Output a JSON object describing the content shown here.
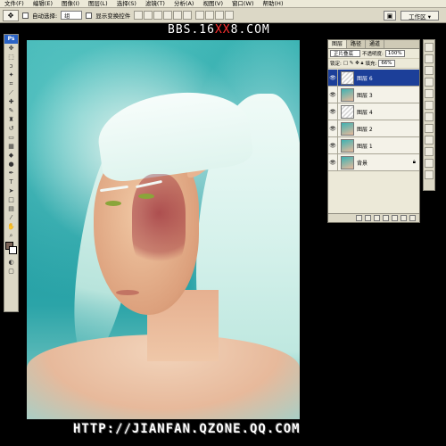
{
  "menu": [
    "文件(F)",
    "编辑(E)",
    "图像(I)",
    "图层(L)",
    "选择(S)",
    "滤镜(T)",
    "分析(A)",
    "视图(V)",
    "窗口(W)",
    "帮助(H)"
  ],
  "options": {
    "auto_select_label": "自动选择:",
    "auto_select_value": "组",
    "show_transform_label": "显示变换控件",
    "workspace_label": "工作区 ▾"
  },
  "watermark_top": {
    "part1": "BBS.16",
    "part2": "XX",
    "part3": "8.COM"
  },
  "watermark_bottom": "HTTP://JIANFAN.QZONE.QQ.COM",
  "toolbox": {
    "logo": "Ps"
  },
  "layers_panel": {
    "tabs": [
      "图层",
      "路径",
      "通道"
    ],
    "blend_mode": "正片叠底",
    "opacity_label": "不透明度:",
    "opacity": "100%",
    "lock_label": "锁定:",
    "fill_label": "填充:",
    "fill": "66%",
    "layers": [
      {
        "name": "图层 6",
        "active": true
      },
      {
        "name": "图层 3",
        "active": false
      },
      {
        "name": "图层 4",
        "active": false
      },
      {
        "name": "图层 2",
        "active": false
      },
      {
        "name": "图层 1",
        "active": false
      },
      {
        "name": "背景",
        "active": false
      }
    ]
  },
  "colors": {
    "foreground": "#7b6457",
    "background": "#ffffff",
    "selected_layer": "#1c3f99"
  }
}
